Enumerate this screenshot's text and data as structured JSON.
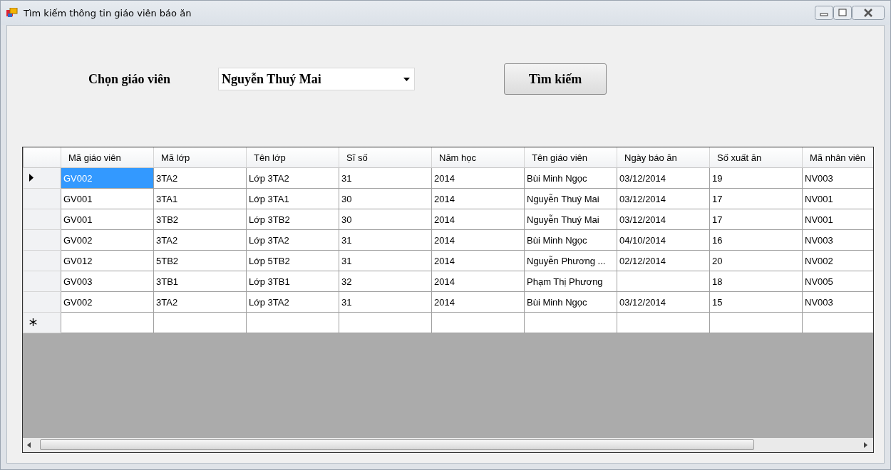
{
  "window": {
    "title": "Tìm kiếm thông tin giáo viên báo ăn"
  },
  "filter": {
    "label": "Chọn giáo viên",
    "teacher": "Nguyễn Thuý Mai",
    "button": "Tìm kiếm"
  },
  "table": {
    "columns": [
      "Mã giáo viên",
      "Mã lớp",
      "Tên lớp",
      "Sĩ số",
      "Năm học",
      "Tên giáo viên",
      "Ngày báo ăn",
      "Số xuất ăn",
      "Mã nhân viên"
    ],
    "rows": [
      {
        "selected": true,
        "cells": [
          "GV002",
          "3TA2",
          "Lớp 3TA2",
          "31",
          "2014",
          "Bùi Minh Ngọc",
          "03/12/2014",
          "19",
          "NV003"
        ]
      },
      {
        "selected": false,
        "cells": [
          "GV001",
          "3TA1",
          "Lớp 3TA1",
          "30",
          "2014",
          "Nguyễn Thuý Mai",
          "03/12/2014",
          "17",
          "NV001"
        ]
      },
      {
        "selected": false,
        "cells": [
          "GV001",
          "3TB2",
          "Lớp 3TB2",
          "30",
          "2014",
          "Nguyễn Thuý Mai",
          "03/12/2014",
          "17",
          "NV001"
        ]
      },
      {
        "selected": false,
        "cells": [
          "GV002",
          "3TA2",
          "Lớp 3TA2",
          "31",
          "2014",
          "Bùi Minh Ngọc",
          "04/10/2014",
          "16",
          "NV003"
        ]
      },
      {
        "selected": false,
        "cells": [
          "GV012",
          "5TB2",
          "Lớp 5TB2",
          "31",
          "2014",
          "Nguyễn Phương ...",
          "02/12/2014",
          "20",
          "NV002"
        ]
      },
      {
        "selected": false,
        "cells": [
          "GV003",
          "3TB1",
          "Lớp 3TB1",
          "32",
          "2014",
          "Phạm Thị Phương",
          "",
          "18",
          "NV005"
        ]
      },
      {
        "selected": false,
        "cells": [
          "GV002",
          "3TA2",
          "Lớp 3TA2",
          "31",
          "2014",
          "Bùi Minh Ngọc",
          "03/12/2014",
          "15",
          "NV003"
        ]
      }
    ]
  }
}
